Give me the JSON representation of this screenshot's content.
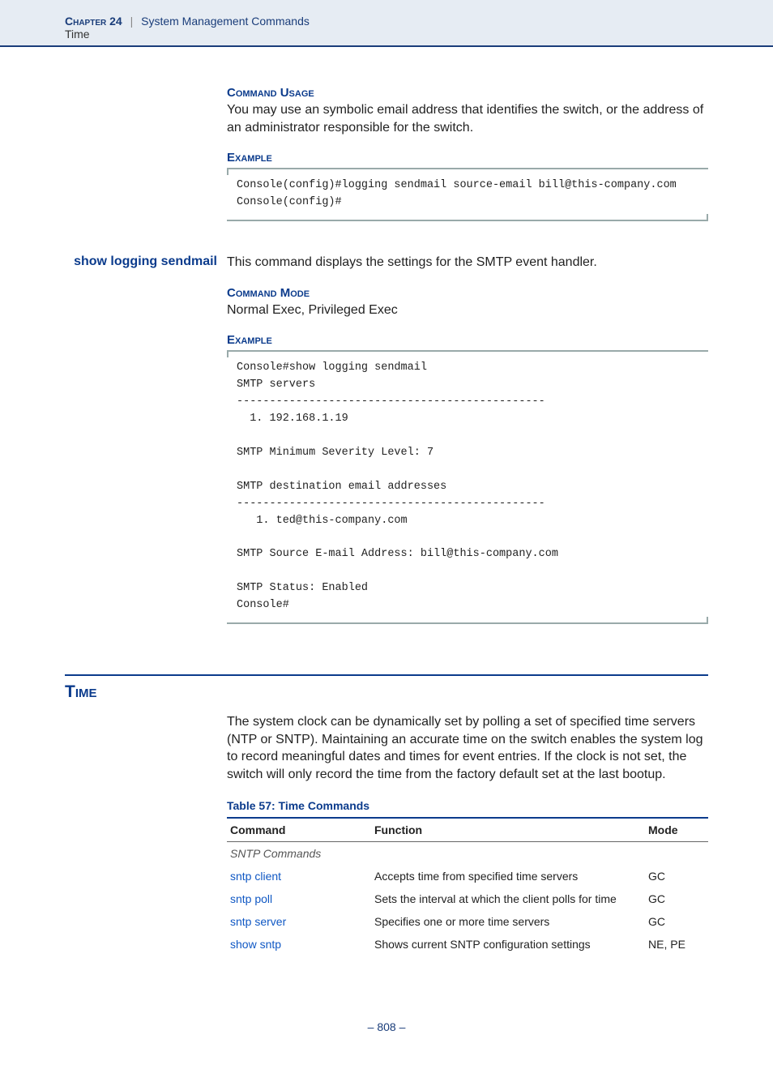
{
  "header": {
    "chapter_label": "Chapter 24",
    "separator": "|",
    "chapter_title": "System Management Commands",
    "subhead": "Time"
  },
  "s1": {
    "usage_h": "Command Usage",
    "usage_text": "You may use an symbolic email address that identifies the switch, or the address of an administrator responsible for the switch.",
    "example_h": "Example",
    "code": "Console(config)#logging sendmail source-email bill@this-company.com\nConsole(config)#"
  },
  "s2": {
    "cmd_name": "show logging sendmail",
    "desc": "This command displays the settings for the SMTP event handler.",
    "mode_h": "Command Mode",
    "mode_text": "Normal Exec, Privileged Exec",
    "example_h": "Example",
    "code": "Console#show logging sendmail\nSMTP servers\n-----------------------------------------------\n  1. 192.168.1.19\n\nSMTP Minimum Severity Level: 7\n\nSMTP destination email addresses\n-----------------------------------------------\n   1. ted@this-company.com\n\nSMTP Source E-mail Address: bill@this-company.com\n\nSMTP Status: Enabled\nConsole#"
  },
  "time": {
    "heading": "Time",
    "intro": "The system clock can be dynamically set by polling a set of specified time servers (NTP or SNTP). Maintaining an accurate time on the switch enables the system log to record meaningful dates and times for event entries. If the clock is not set, the switch will only record the time from the factory default set at the last bootup.",
    "table_caption": "Table 57: Time Commands",
    "th_cmd": "Command",
    "th_func": "Function",
    "th_mode": "Mode",
    "subgroup": "SNTP Commands",
    "rows": [
      {
        "cmd": "sntp client",
        "func": "Accepts time from specified time servers",
        "mode": "GC"
      },
      {
        "cmd": "sntp poll",
        "func": "Sets the interval at which the client polls for time",
        "mode": "GC"
      },
      {
        "cmd": "sntp server",
        "func": "Specifies one or more time servers",
        "mode": "GC"
      },
      {
        "cmd": "show sntp",
        "func": "Shows current SNTP configuration settings",
        "mode": "NE, PE"
      }
    ]
  },
  "footer": {
    "page": "–  808  –"
  }
}
